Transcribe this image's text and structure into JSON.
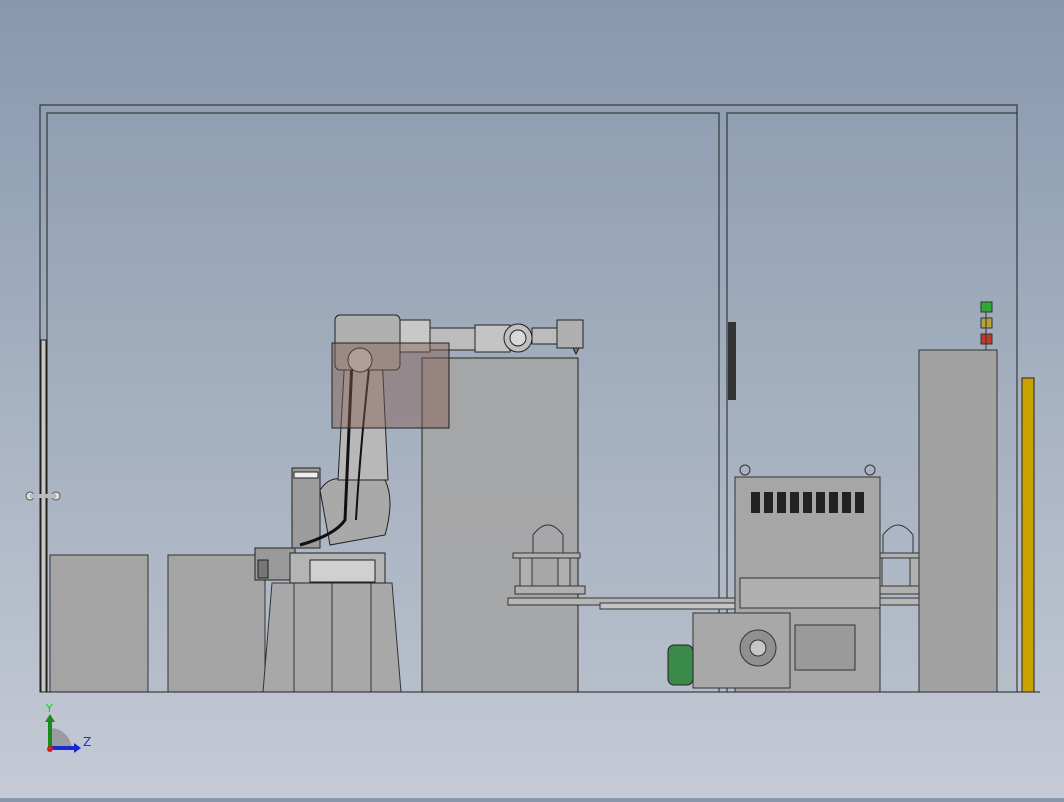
{
  "triad": {
    "y_label": "Y",
    "z_label": "Z"
  },
  "colors": {
    "stack_light_green": "#2fa83a",
    "stack_light_yellow": "#b8a23a",
    "stack_light_red": "#c0392b",
    "light_curtain": "#c9a400",
    "motor_green": "#3a8a4a"
  }
}
